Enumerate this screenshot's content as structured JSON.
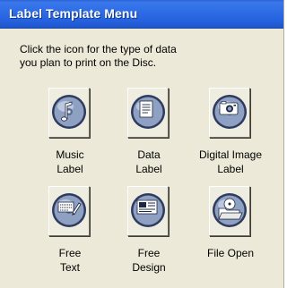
{
  "window": {
    "title": "Label Template Menu"
  },
  "instruction": {
    "line1": "Click the icon for the type of data",
    "line2": "you plan to print on the Disc."
  },
  "tiles": [
    {
      "line1": "Music",
      "line2": "Label",
      "icon": "music-disc-icon"
    },
    {
      "line1": "Data",
      "line2": "Label",
      "icon": "data-disc-icon"
    },
    {
      "line1": "Digital Image",
      "line2": "Label",
      "icon": "digital-image-disc-icon"
    },
    {
      "line1": "Free",
      "line2": "Text",
      "icon": "free-text-disc-icon"
    },
    {
      "line1": "Free",
      "line2": "Design",
      "icon": "free-design-disc-icon"
    },
    {
      "line1": "File Open",
      "line2": "",
      "icon": "file-open-icon"
    }
  ],
  "colors": {
    "titlebar": "#2f6de6",
    "dialog_background": "#ece9d8",
    "disc_ring": "#3b4c73",
    "disc_face": "#9fb0cc"
  }
}
